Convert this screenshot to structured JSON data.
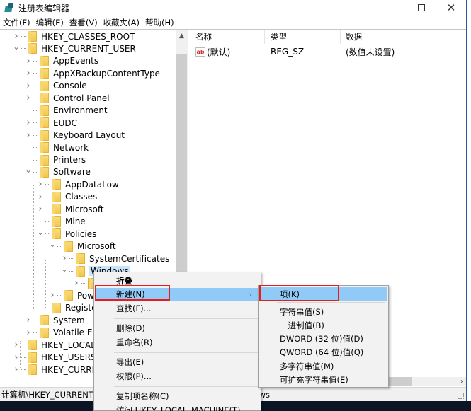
{
  "window": {
    "title": "注册表编辑器",
    "controls": {
      "minimize": "—",
      "maximize": "□",
      "close": "✕"
    }
  },
  "menubar": [
    {
      "label": "文件(F)"
    },
    {
      "label": "编辑(E)"
    },
    {
      "label": "查看(V)"
    },
    {
      "label": "收藏夹(A)"
    },
    {
      "label": "帮助(H)"
    }
  ],
  "tree": {
    "items": [
      {
        "label": "HKEY_CLASSES_ROOT",
        "level": 0,
        "expander": "collapsed"
      },
      {
        "label": "HKEY_CURRENT_USER",
        "level": 0,
        "expander": "expanded"
      },
      {
        "label": "AppEvents",
        "level": 1,
        "expander": "collapsed"
      },
      {
        "label": "AppXBackupContentType",
        "level": 1,
        "expander": "collapsed"
      },
      {
        "label": "Console",
        "level": 1,
        "expander": "collapsed"
      },
      {
        "label": "Control Panel",
        "level": 1,
        "expander": "collapsed"
      },
      {
        "label": "Environment",
        "level": 1,
        "expander": "none"
      },
      {
        "label": "EUDC",
        "level": 1,
        "expander": "collapsed"
      },
      {
        "label": "Keyboard Layout",
        "level": 1,
        "expander": "collapsed"
      },
      {
        "label": "Network",
        "level": 1,
        "expander": "none"
      },
      {
        "label": "Printers",
        "level": 1,
        "expander": "none"
      },
      {
        "label": "Software",
        "level": 1,
        "expander": "expanded"
      },
      {
        "label": "AppDataLow",
        "level": 2,
        "expander": "collapsed"
      },
      {
        "label": "Classes",
        "level": 2,
        "expander": "collapsed"
      },
      {
        "label": "Microsoft",
        "level": 2,
        "expander": "collapsed"
      },
      {
        "label": "Mine",
        "level": 2,
        "expander": "none"
      },
      {
        "label": "Policies",
        "level": 2,
        "expander": "expanded"
      },
      {
        "label": "Microsoft",
        "level": 3,
        "expander": "expanded"
      },
      {
        "label": "SystemCertificates",
        "level": 4,
        "expander": "collapsed"
      },
      {
        "label": "Windows",
        "level": 4,
        "expander": "expanded",
        "selected": true
      },
      {
        "label": "",
        "level": 5,
        "expander": "collapsed"
      },
      {
        "label": "Power",
        "level": 3,
        "expander": "collapsed"
      },
      {
        "label": "RegisteredApplications",
        "level": 2,
        "expander": "none"
      },
      {
        "label": "System",
        "level": 1,
        "expander": "collapsed"
      },
      {
        "label": "Volatile Environment",
        "level": 1,
        "expander": "collapsed"
      },
      {
        "label": "HKEY_LOCAL_MACHINE",
        "level": 0,
        "expander": "collapsed"
      },
      {
        "label": "HKEY_USERS",
        "level": 0,
        "expander": "collapsed"
      },
      {
        "label": "HKEY_CURRENT_CONFIG",
        "level": 0,
        "expander": "collapsed"
      }
    ]
  },
  "values": {
    "columns": [
      "名称",
      "类型",
      "数据"
    ],
    "rows": [
      {
        "name": "(默认)",
        "type": "REG_SZ",
        "data": "(数值未设置)",
        "icon": "string-value-icon"
      }
    ]
  },
  "status_bar": {
    "path": "计算机\\HKEY_CURRENT_USER\\Software\\Policies\\Microsoft\\Windows"
  },
  "context_menu": {
    "items": [
      {
        "label": "折叠",
        "bold": true
      },
      {
        "label": "新建(N)",
        "submenu": true,
        "highlighted": true,
        "arrow": "›"
      },
      {
        "label": "查找(F)..."
      },
      {
        "separator": true
      },
      {
        "label": "删除(D)"
      },
      {
        "label": "重命名(R)"
      },
      {
        "separator": true
      },
      {
        "label": "导出(E)"
      },
      {
        "label": "权限(P)..."
      },
      {
        "separator": true
      },
      {
        "label": "复制项名称(C)"
      },
      {
        "label": "访问 HKEY_LOCAL_MACHINE(T)"
      }
    ]
  },
  "submenu": {
    "items": [
      {
        "label": "项(K)",
        "highlighted": true
      },
      {
        "separator": true
      },
      {
        "label": "字符串值(S)"
      },
      {
        "label": "二进制值(B)"
      },
      {
        "label": "DWORD (32 位)值(D)"
      },
      {
        "label": "QWORD (64 位)值(Q)"
      },
      {
        "label": "多字符串值(M)"
      },
      {
        "label": "可扩充字符串值(E)"
      }
    ]
  },
  "annotation_color": "#e02020",
  "highlight_color": "#91c9f7"
}
